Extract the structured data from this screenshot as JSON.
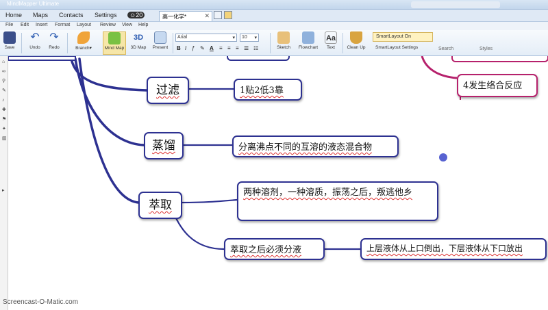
{
  "window": {
    "title": "MindMapper Ultimate"
  },
  "menu_tabs": [
    {
      "label": "Home"
    },
    {
      "label": "Maps"
    },
    {
      "label": "Contacts"
    },
    {
      "label": "Settings"
    },
    {
      "label": "20"
    }
  ],
  "doc_tab": {
    "label": "高一化学*",
    "close": "✕"
  },
  "ribbon_tabs": [
    "File",
    "Edit",
    "Insert",
    "Format",
    "Layout",
    "Review",
    "View",
    "Help"
  ],
  "ribbon": {
    "save": "Save",
    "undo": "Undo",
    "redo": "Redo",
    "branch": "Branch",
    "mindmap": "Mind Map",
    "map3d": "3D Map",
    "present": "Present",
    "font": "Arial",
    "size": "10",
    "sketch": "Sketch",
    "flowchart": "Flowchart",
    "text": "Text",
    "cleanup": "Clean Up",
    "smart_on": "SmartLayout On",
    "smart_settings": "SmartLayout Settings",
    "search": "Search",
    "styles": "Styles"
  },
  "colors": {
    "branch": "#2d3191",
    "pink_branch": "#b6216c",
    "accent": "#f6e6a8"
  },
  "map": {
    "topics": [
      {
        "label": "过滤",
        "detail": "1贴2低3靠"
      },
      {
        "label": "蒸馏",
        "detail": "分离沸点不同的互溶的液态混合物"
      },
      {
        "label": "萃取",
        "detail": "两种溶剂，一种溶质，振荡之后，叛逃他乡"
      }
    ],
    "sub_branch": "萃取之后必须分液",
    "sub_detail": "上层液体从上口倒出，下层液体从下口放出",
    "pink_node": "4发生络合反应"
  },
  "watermark": "Screencast-O-Matic.com"
}
